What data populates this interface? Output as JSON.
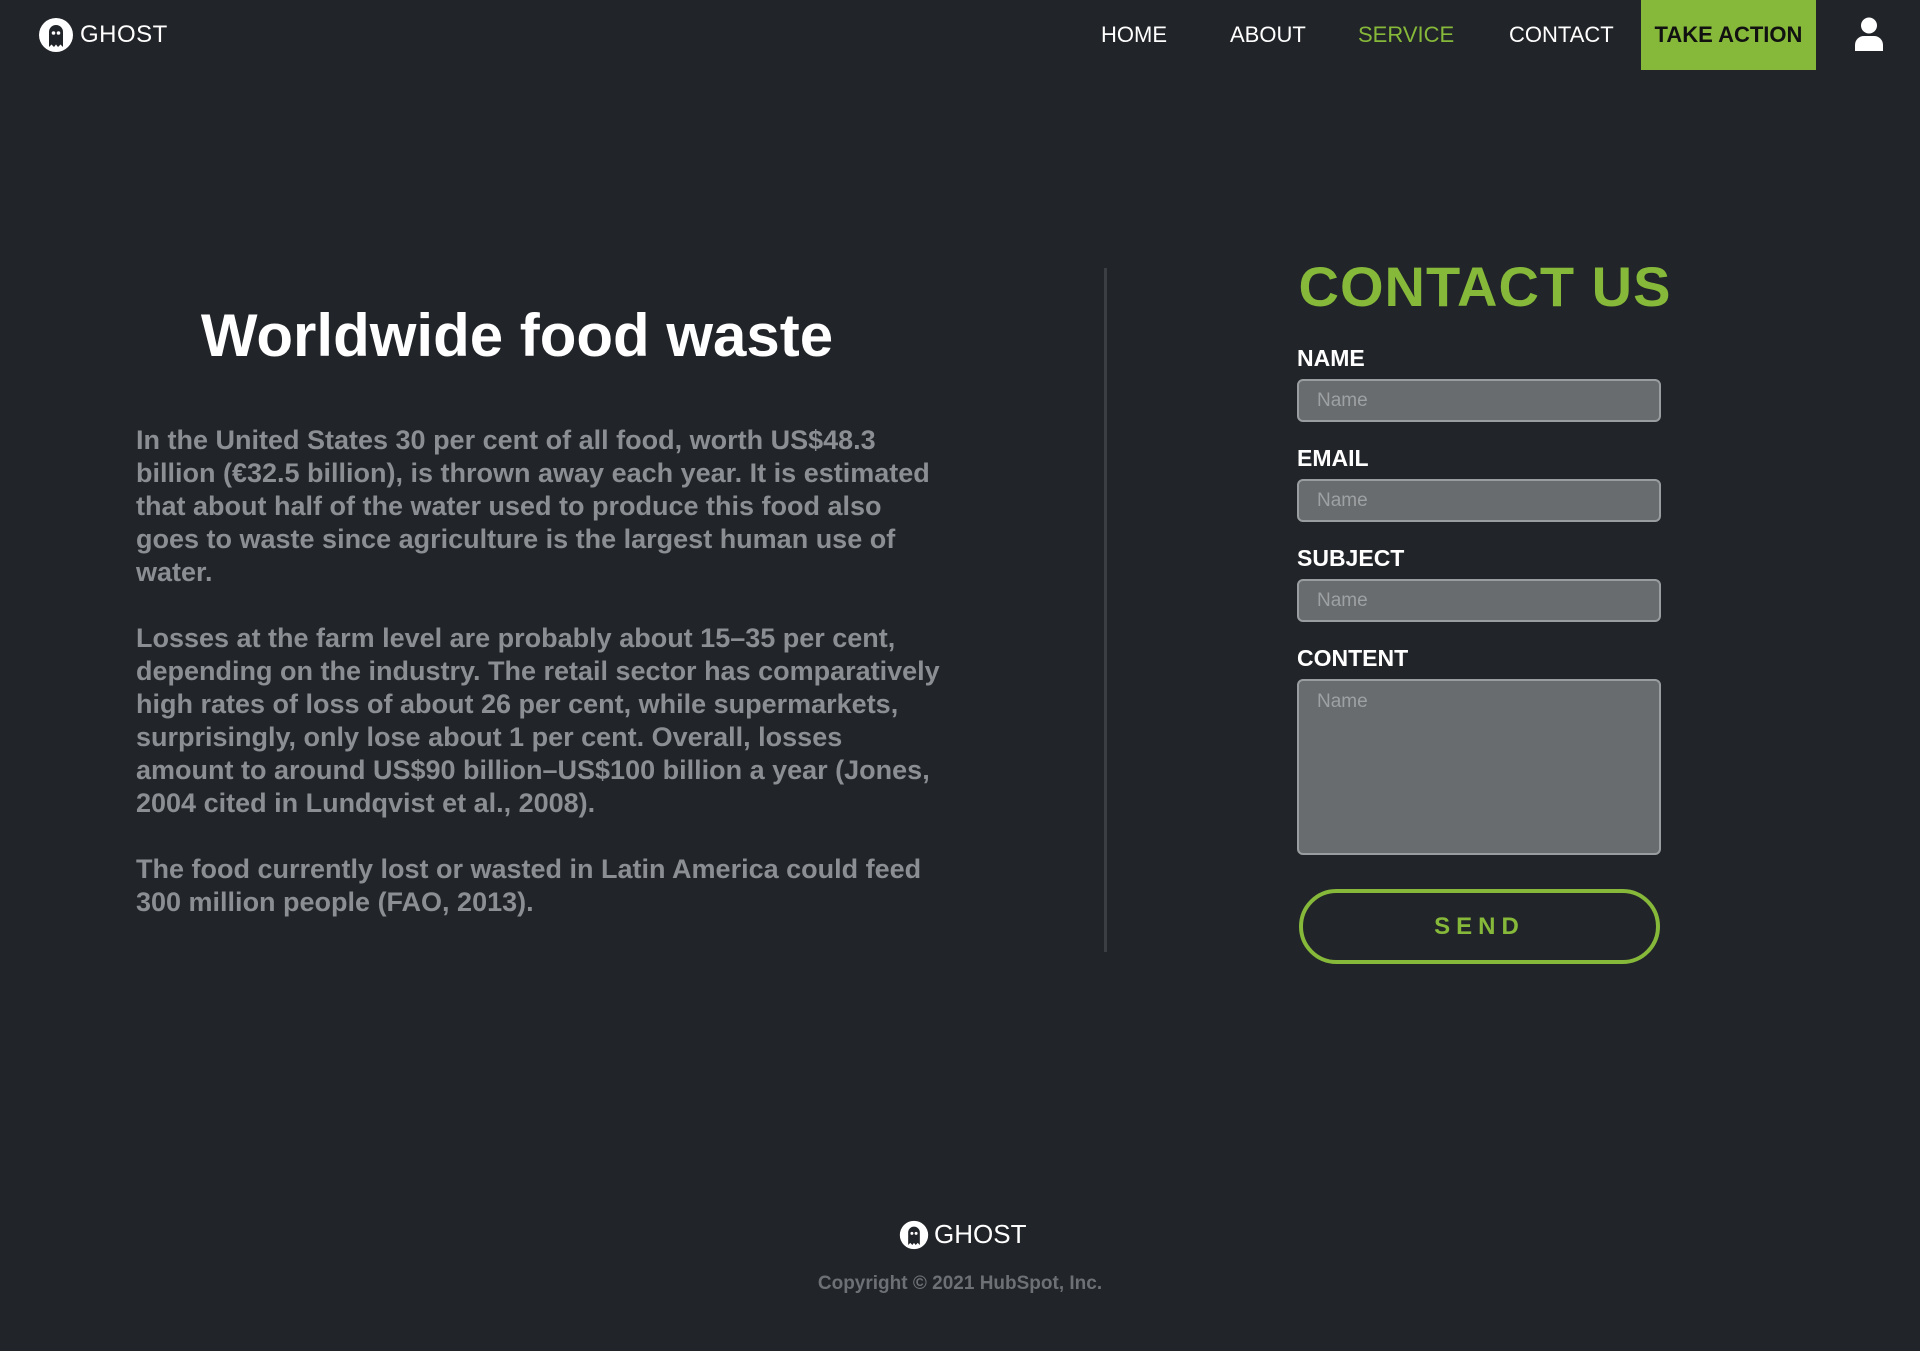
{
  "brand": {
    "name": "GHOST",
    "logo_icon": "ghost-logo-icon"
  },
  "nav": {
    "links": [
      "HOME",
      "ABOUT",
      "SERVICE",
      "CONTACT"
    ],
    "active": "SERVICE",
    "cta_label": "TAKE ACTION",
    "user_icon": "user-icon"
  },
  "article": {
    "title": "Worldwide food waste",
    "paragraphs": [
      "In the United States 30 per cent of all food, worth US$48.3 billion (€32.5 billion), is thrown away each year. It is estimated that about half of the water used to produce this food also goes to waste since agriculture is the largest human use of water.",
      "Losses at the farm level are probably about 15–35 per cent, depending on the industry. The retail sector has comparatively high rates of loss of about 26 per cent, while supermarkets, surprisingly, only lose about 1 per cent. Overall, losses amount to around US$90 billion–US$100 billion a year (Jones, 2004 cited in Lundqvist et al., 2008).",
      "The food currently lost or wasted in Latin America could feed 300 million people (FAO, 2013)."
    ]
  },
  "contact": {
    "title": "CONTACT US",
    "fields": {
      "name": {
        "label": "NAME",
        "placeholder": "Name",
        "value": ""
      },
      "email": {
        "label": "EMAIL",
        "placeholder": "Name",
        "value": ""
      },
      "subject": {
        "label": "SUBJECT",
        "placeholder": "Name",
        "value": ""
      },
      "content": {
        "label": "CONTENT",
        "placeholder": "Name",
        "value": ""
      }
    },
    "send_label": "SEND"
  },
  "footer": {
    "brand": "GHOST",
    "copyright": "Copyright © 2021 HubSpot, Inc."
  },
  "colors": {
    "background": "#212428",
    "accent": "#86b83a",
    "body_text": "#8b8f94",
    "input_bg": "#696c6e"
  }
}
